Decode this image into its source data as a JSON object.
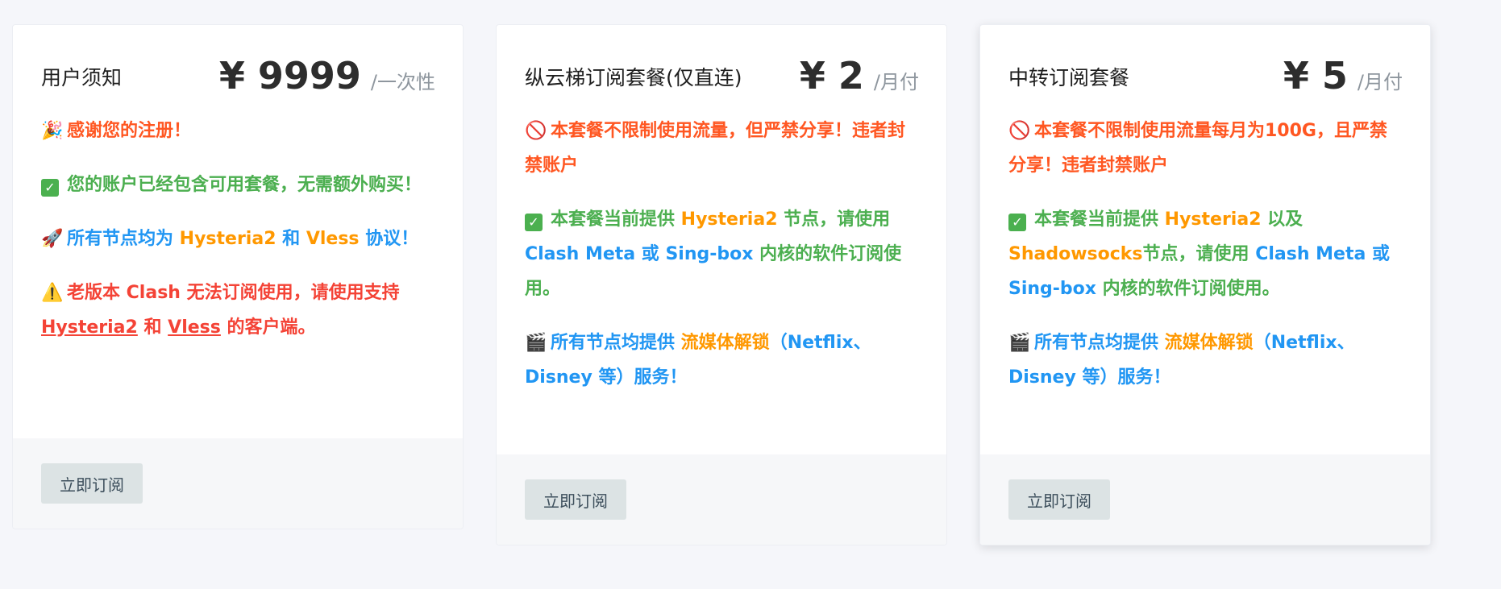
{
  "colors": {
    "red": "#f44336",
    "orange": "#ff5722",
    "green": "#4caf50",
    "blue": "#2196f3",
    "amber": "#ff9800"
  },
  "plans": [
    {
      "title": "用户须知",
      "price": "¥ 9999",
      "unit": "/一次性",
      "button": "立即订阅",
      "lines": {
        "l1": {
          "icon": "party-popper-icon",
          "text": "感谢您的注册！"
        },
        "l2": {
          "icon": "check-mark-icon",
          "text": "您的账户已经包含可用套餐，无需额外购买！"
        },
        "l3": {
          "icon": "rocket-icon",
          "t1": "所有节点均为 ",
          "t2": "Hysteria2",
          "t3": " 和 ",
          "t4": "Vless",
          "t5": " 协议！"
        },
        "l4": {
          "icon": "warning-icon",
          "t1": "老版本 Clash 无法订阅使用，请使用支持 ",
          "t2": "Hysteria2",
          "t3": " 和 ",
          "t4": "Vless",
          "t5": " 的客户端。"
        }
      }
    },
    {
      "title": "纵云梯订阅套餐(仅直连)",
      "price": "¥ 2",
      "unit": "/月付",
      "button": "立即订阅",
      "lines": {
        "l1": {
          "icon": "prohibited-icon",
          "text": "本套餐不限制使用流量，但严禁分享！违者封禁账户"
        },
        "l2": {
          "icon": "check-mark-icon",
          "t1": "本套餐当前提供 ",
          "t2": "Hysteria2",
          "t3": " 节点，请使用 ",
          "t4": "Clash Meta",
          "t5": " 或 ",
          "t6": "Sing-box",
          "t7": " 内核的软件订阅使用。"
        },
        "l3": {
          "icon": "clapper-board-icon",
          "t1": "所有节点均提供 ",
          "t2": "流媒体解锁",
          "t3": "（Netflix、Disney 等）服务！"
        }
      }
    },
    {
      "title": "中转订阅套餐",
      "price": "¥ 5",
      "unit": "/月付",
      "button": "立即订阅",
      "lines": {
        "l1": {
          "icon": "prohibited-icon",
          "text": "本套餐不限制使用流量每月为100G，且严禁分享！违者封禁账户"
        },
        "l2": {
          "icon": "check-mark-icon",
          "t1": "本套餐当前提供 ",
          "t2": "Hysteria2",
          "t3": " 以及 ",
          "t4": "Shadowsocks",
          "t5": "节点，请使用 ",
          "t6": "Clash Meta",
          "t7": " 或 ",
          "t8": "Sing-box",
          "t9": " 内核的软件订阅使用。"
        },
        "l3": {
          "icon": "clapper-board-icon",
          "t1": "所有节点均提供 ",
          "t2": "流媒体解锁",
          "t3": "（Netflix、Disney 等）服务！"
        }
      }
    }
  ]
}
